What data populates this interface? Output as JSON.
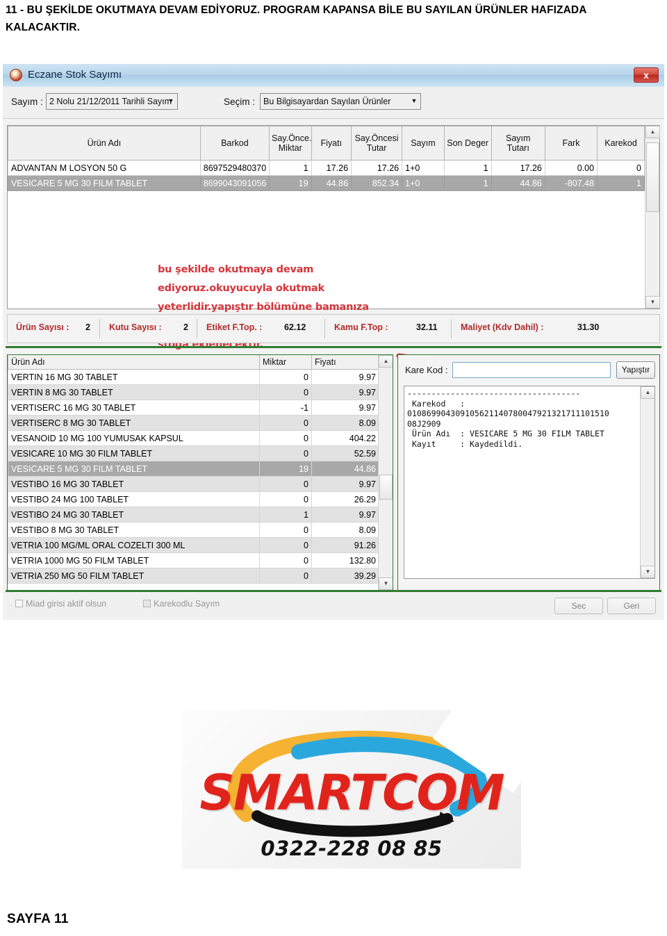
{
  "document": {
    "heading": "11 -  BU ŞEKİLDE OKUTMAYA DEVAM EDİYORUZ. PROGRAM KAPANSA BİLE BU SAYILAN ÜRÜNLER HAFIZADA KALACAKTIR.",
    "footer": "SAYFA 11"
  },
  "window": {
    "title": "Eczane Stok Sayımı",
    "close_label": "x",
    "icon": "app-icon"
  },
  "toolbar": {
    "sayim_label": "Sayım :",
    "sayim_value": "2 Nolu 21/12/2011 Tarihli Sayım",
    "secim_label": "Seçim :",
    "secim_value": "Bu Bilgisayardan Sayılan Ürünler",
    "dropdown_glyph": "▼"
  },
  "main_grid": {
    "columns": [
      "Ürün Adı",
      "Barkod",
      "Say.Önce. Miktar",
      "Fiyatı",
      "Say.Öncesi Tutar",
      "Sayım",
      "Son Deger",
      "Sayım Tutarı",
      "Fark",
      "Karekod"
    ],
    "rows": [
      {
        "urun_adi": "ADVANTAN M LOSYON 50 G",
        "barkod": "8697529480370",
        "say_once_miktar": "1",
        "fiyati": "17.26",
        "say_oncesi_tutar": "17.26",
        "sayim": "1+0",
        "son_deger": "1",
        "sayim_tutari": "17.26",
        "fark": "0.00",
        "karekod": "0",
        "selected": false
      },
      {
        "urun_adi": "VESICARE 5 MG 30 FILM TABLET",
        "barkod": "8699043091056",
        "say_once_miktar": "19",
        "fiyati": "44.86",
        "say_oncesi_tutar": "852.34",
        "sayim": "1+0",
        "son_deger": "1",
        "sayim_tutari": "44.86",
        "fark": "-807.48",
        "karekod": "1",
        "selected": true
      }
    ]
  },
  "annotation": {
    "text": "bu şekilde okutmaya devam ediyoruz.okuyucuyla okutmak yeterlidir.yapıştır bölümüne bamanıza gerek yoktur.okuttukça ürünler tek tek stoğa eklenecektir.",
    "color": "#d6343a",
    "arrow": "red-arrow"
  },
  "summary": {
    "items": [
      {
        "label": "Ürün Sayısı :",
        "value": "2"
      },
      {
        "label": "Kutu Sayısı :",
        "value": "2"
      },
      {
        "label": "Etiket F.Top. :",
        "value": "62.12"
      },
      {
        "label": "Kamu F.Top :",
        "value": "32.11"
      },
      {
        "label": "Maliyet (Kdv Dahil) :",
        "value": "31.30"
      }
    ],
    "label_color": "#b02a2a"
  },
  "product_list": {
    "columns": [
      "Ürün Adı",
      "Miktar",
      "Fiyatı"
    ],
    "rows": [
      {
        "ad": "VERTIN 16 MG 30 TABLET",
        "miktar": "0",
        "fiyat": "9.97",
        "selected": false
      },
      {
        "ad": "VERTIN 8 MG 30 TABLET",
        "miktar": "0",
        "fiyat": "9.97",
        "selected": false
      },
      {
        "ad": "VERTISERC 16 MG 30 TABLET",
        "miktar": "-1",
        "fiyat": "9.97",
        "selected": false
      },
      {
        "ad": "VERTISERC 8 MG 30 TABLET",
        "miktar": "0",
        "fiyat": "8.09",
        "selected": false
      },
      {
        "ad": "VESANOID 10 MG 100 YUMUSAK KAPSUL",
        "miktar": "0",
        "fiyat": "404.22",
        "selected": false
      },
      {
        "ad": "VESICARE 10 MG 30 FILM TABLET",
        "miktar": "0",
        "fiyat": "52.59",
        "selected": false
      },
      {
        "ad": "VESICARE 5 MG 30 FILM TABLET",
        "miktar": "19",
        "fiyat": "44.86",
        "selected": true
      },
      {
        "ad": "VESTIBO 16 MG 30 TABLET",
        "miktar": "0",
        "fiyat": "9.97",
        "selected": false
      },
      {
        "ad": "VESTIBO 24 MG 100 TABLET",
        "miktar": "0",
        "fiyat": "26.29",
        "selected": false
      },
      {
        "ad": "VESTIBO 24 MG 30 TABLET",
        "miktar": "1",
        "fiyat": "9.97",
        "selected": false
      },
      {
        "ad": "VESTIBO 8 MG 30 TABLET",
        "miktar": "0",
        "fiyat": "8.09",
        "selected": false
      },
      {
        "ad": "VETRIA 100 MG/ML ORAL COZELTI 300 ML",
        "miktar": "0",
        "fiyat": "91.26",
        "selected": false
      },
      {
        "ad": "VETRIA 1000 MG 50 FILM TABLET",
        "miktar": "0",
        "fiyat": "132.80",
        "selected": false
      },
      {
        "ad": "VETRIA 250 MG 50 FILM TABLET",
        "miktar": "0",
        "fiyat": "39.29",
        "selected": false
      }
    ]
  },
  "karekod_panel": {
    "label": "Kare Kod :",
    "input_value": "",
    "paste_button": "Yapıştır",
    "log": "------------------------------------\n Karekod   :\n010869904309105621140780047921321711101510\n08J2909\n Ürün Adı  : VESICARE 5 MG 30 FILM TABLET\n Kayıt     : Kaydedildi."
  },
  "bottom_bar": {
    "checkbox_1": "Miad girisi aktif olsun",
    "checkbox_2": "Karekodlu Sayım",
    "checkbox_1_checked": false,
    "checkbox_2_checked": true,
    "button_1": "Sec",
    "button_2": "Geri"
  },
  "logo": {
    "word": "SMARTCOM",
    "phone": "0322-228 08 85",
    "red": "#e1241b",
    "yellow": "#f5b233",
    "blue": "#2aa8dd",
    "black": "#111111"
  }
}
